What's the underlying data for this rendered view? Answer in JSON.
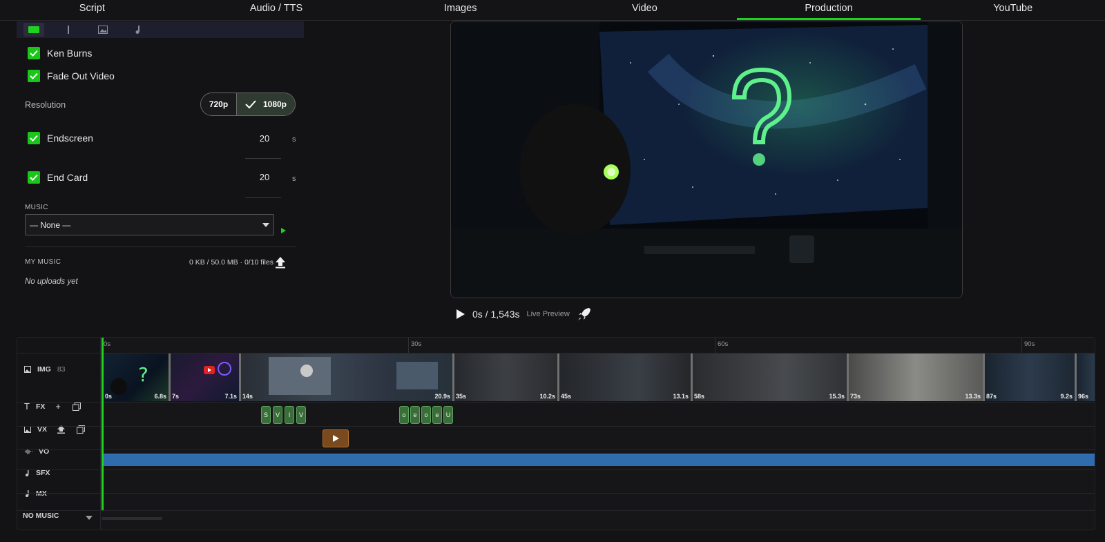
{
  "nav": {
    "tabs": [
      "Script",
      "Audio / TTS",
      "Images",
      "Video",
      "Production",
      "YouTube"
    ],
    "active": "Production"
  },
  "settings": {
    "ken_burns": {
      "label": "Ken Burns",
      "checked": true
    },
    "fade_out": {
      "label": "Fade Out Video",
      "checked": true
    },
    "resolution": {
      "label": "Resolution",
      "option_a": "720p",
      "option_b": "1080p",
      "selected": "1080p"
    },
    "endscreen": {
      "label": "Endscreen",
      "value": "20",
      "unit": "s",
      "checked": true
    },
    "end_card": {
      "label": "End Card",
      "value": "20",
      "unit": "s",
      "checked": true
    },
    "music": {
      "label": "MUSIC",
      "selected": "— None —"
    },
    "my_music": {
      "label": "MY MUSIC",
      "usage": "0 KB / 50.0 MB · 0/10 files",
      "empty": "No uploads yet"
    }
  },
  "preview": {
    "time": "0s / 1,543s",
    "live_label": "Live Preview"
  },
  "timeline": {
    "ruler": [
      "0s",
      "30s",
      "60s",
      "90s"
    ],
    "tracks": {
      "img": "IMG",
      "img_count": "83",
      "fx": "FX",
      "vx": "VX",
      "vo": "VO",
      "sfx": "SFX",
      "mx": "MX"
    },
    "music_select": "NO MUSIC",
    "img_clips": [
      {
        "start": "0s",
        "dur": "6.8s"
      },
      {
        "start": "7s",
        "dur": "7.1s"
      },
      {
        "start": "14s",
        "dur": "20.9s"
      },
      {
        "start": "35s",
        "dur": "10.2s"
      },
      {
        "start": "45s",
        "dur": "13.1s"
      },
      {
        "start": "58s",
        "dur": "15.3s"
      },
      {
        "start": "73s",
        "dur": "13.3s"
      },
      {
        "start": "87s",
        "dur": "9.2s"
      },
      {
        "start": "96s",
        "dur": ""
      }
    ],
    "fx_clips": [
      "S",
      "V",
      "I",
      "V",
      "o",
      "e",
      "o",
      "e",
      "U"
    ]
  },
  "colors": {
    "accent": "#1fd21f",
    "vo": "#2e6cad",
    "vx": "#7a4a1e"
  }
}
